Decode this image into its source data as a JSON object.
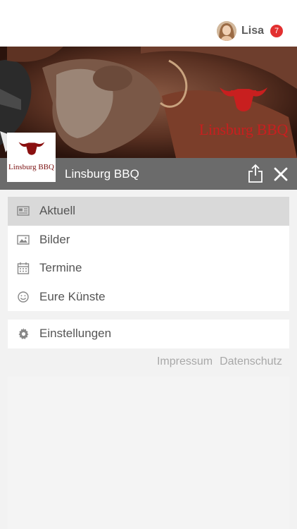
{
  "user": {
    "name": "Lisa",
    "notifications": "7"
  },
  "hero": {
    "brand_text": "Linsburg BBQ"
  },
  "logo": {
    "text": "Linsburg BBQ"
  },
  "header": {
    "title": "Linsburg BBQ",
    "share_icon": "share-icon",
    "close_icon": "close-icon"
  },
  "menu": {
    "items": [
      {
        "label": "Aktuell",
        "icon": "newspaper-icon",
        "active": true
      },
      {
        "label": "Bilder",
        "icon": "image-icon",
        "active": false
      },
      {
        "label": "Termine",
        "icon": "calendar-icon",
        "active": false
      },
      {
        "label": "Eure Künste",
        "icon": "smiley-icon",
        "active": false
      }
    ],
    "settings": {
      "label": "Einstellungen",
      "icon": "gear-icon"
    }
  },
  "footer": {
    "impressum": "Impressum",
    "datenschutz": "Datenschutz"
  },
  "colors": {
    "badge": "#e23030",
    "brand_red": "#c81f1f",
    "header_bar": "#6b6b6b",
    "active_item": "#d9d9d9"
  }
}
